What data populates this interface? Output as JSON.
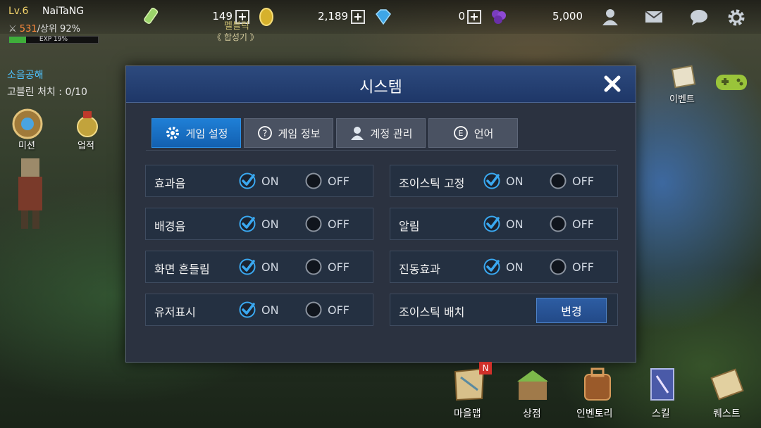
{
  "player": {
    "level": "Lv.6",
    "name": "NaiTaNG",
    "power": "531",
    "rank": "/상위 92%",
    "exp_label": "EXP 19%",
    "exp_fraction": 0.19
  },
  "currency": {
    "gold": "149",
    "gems": "2,189",
    "purple": "0",
    "points": "5,000"
  },
  "area": {
    "line1": "펠블릭",
    "line2": "《 합성기 》"
  },
  "quest": {
    "title": "소음공해",
    "progress": "고블린 처치 : 0/10"
  },
  "side": {
    "mission": "미션",
    "achievement": "업적",
    "event": "이벤트"
  },
  "dialog": {
    "title": "시스템",
    "tabs": [
      {
        "label": "게임 설정",
        "icon": "gear-icon"
      },
      {
        "label": "게임 정보",
        "icon": "question-icon"
      },
      {
        "label": "계정 관리",
        "icon": "person-icon"
      },
      {
        "label": "언어",
        "icon": "language-e-icon"
      }
    ],
    "on_label": "ON",
    "off_label": "OFF",
    "settings_left": [
      {
        "label": "효과음",
        "value": "ON"
      },
      {
        "label": "배경음",
        "value": "ON"
      },
      {
        "label": "화면 흔들림",
        "value": "ON"
      },
      {
        "label": "유저표시",
        "value": "ON"
      }
    ],
    "settings_right": [
      {
        "label": "조이스틱 고정",
        "value": "ON"
      },
      {
        "label": "알림",
        "value": "ON"
      },
      {
        "label": "진동효과",
        "value": "ON"
      }
    ],
    "joystick_layout": {
      "label": "조이스틱 배치",
      "button": "변경"
    }
  },
  "bottom_menu": [
    "마을맵",
    "상점",
    "인벤토리",
    "스킬",
    "퀘스트"
  ],
  "badge": "N",
  "colors": {
    "accent": "#1f7fd6",
    "header": "#1e3768",
    "check": "#3aa8f0",
    "gold": "#f2d36b"
  }
}
